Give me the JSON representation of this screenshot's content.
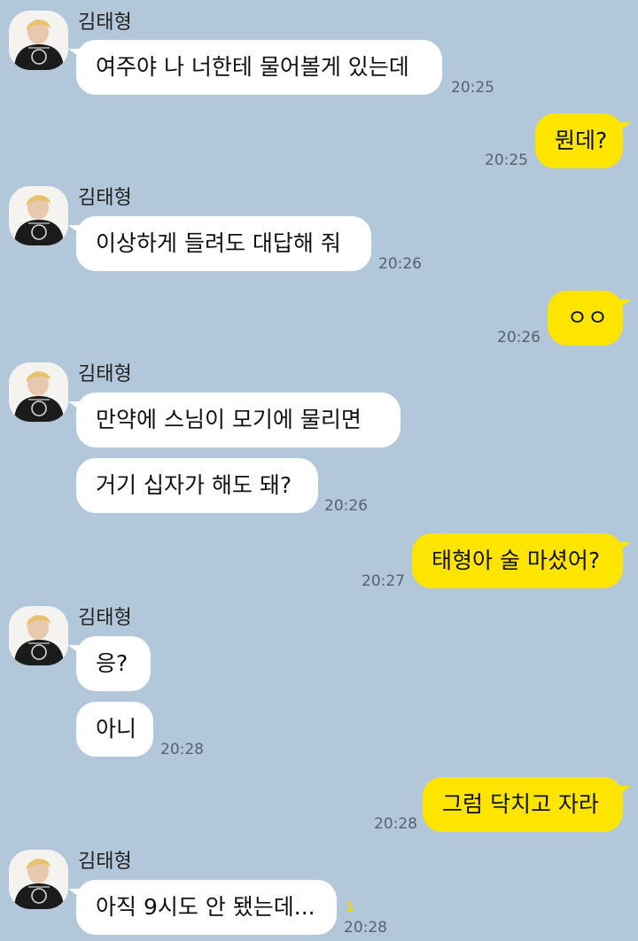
{
  "chat": {
    "sender_name": "김태형",
    "colors": {
      "background": "#b2c7da",
      "incoming_bubble": "#ffffff",
      "outgoing_bubble": "#fee500",
      "unread_count": "#f2d21d"
    },
    "messages": [
      {
        "from": "김태형",
        "text": "여주야 나 너한테 물어볼게 있는데",
        "time": "20:25"
      },
      {
        "from": "me",
        "text": "뭔데?",
        "time": "20:25"
      },
      {
        "from": "김태형",
        "text": "이상하게 들려도 대답해 줘",
        "time": "20:26"
      },
      {
        "from": "me",
        "text": "ㅇㅇ",
        "time": "20:26"
      },
      {
        "from": "김태형",
        "text": "만약에 스님이 모기에 물리면"
      },
      {
        "from": "김태형",
        "text": "거기 십자가 해도 돼?",
        "time": "20:26"
      },
      {
        "from": "me",
        "text": "태형아 술 마셨어?",
        "time": "20:27"
      },
      {
        "from": "김태형",
        "text": "응?"
      },
      {
        "from": "김태형",
        "text": "아니",
        "time": "20:28"
      },
      {
        "from": "me",
        "text": "그럼 닥치고 자라",
        "time": "20:28"
      },
      {
        "from": "김태형",
        "text": "아직 9시도 안 됐는데...",
        "time": "20:28",
        "unread": "1"
      }
    ]
  }
}
